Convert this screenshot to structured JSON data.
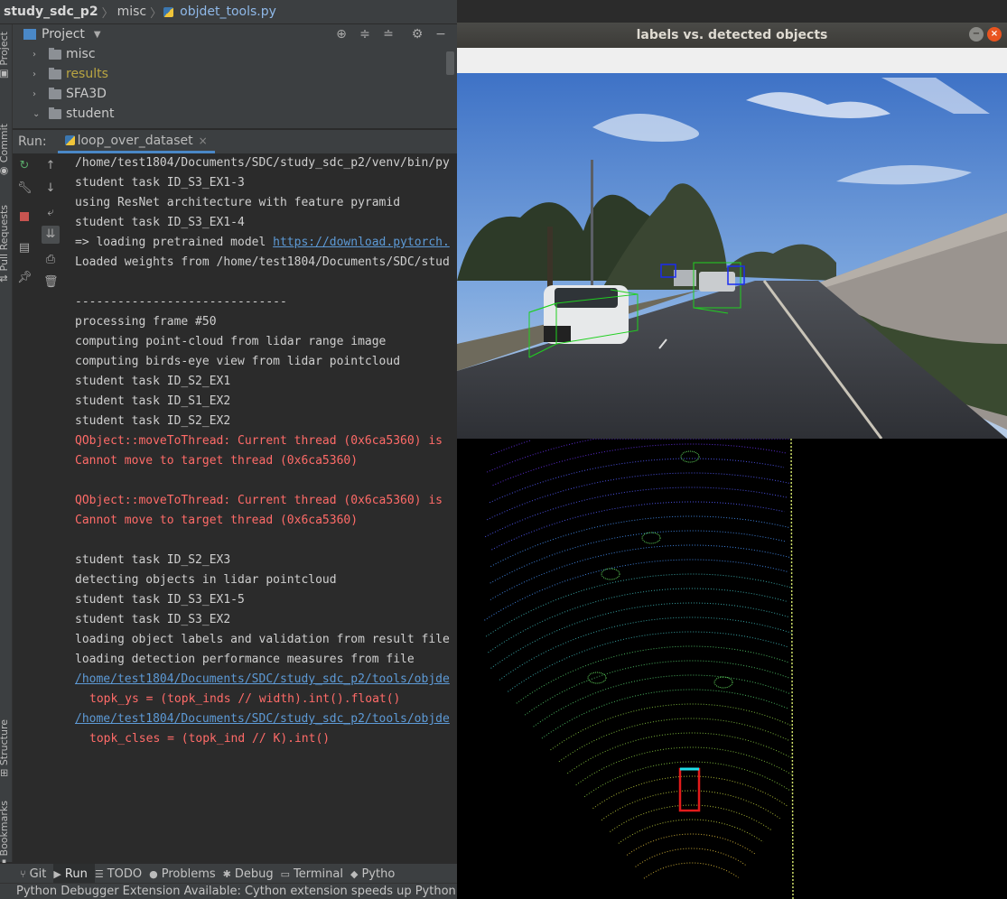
{
  "breadcrumb": {
    "project": "study_sdc_p2",
    "folder": "misc",
    "file": "objdet_tools.py"
  },
  "left_strip": {
    "project_tab": "Project",
    "commit_tab": "Commit",
    "pull_tab": "Pull Requests",
    "structure_tab": "Structure",
    "bookmarks_tab": "Bookmarks"
  },
  "project_panel": {
    "title": "Project",
    "items": [
      {
        "label": "misc",
        "color": "#c9c9c9",
        "expanded": false
      },
      {
        "label": "results",
        "color": "#b9a542",
        "expanded": false
      },
      {
        "label": "SFA3D",
        "color": "#c9c9c9",
        "expanded": false
      },
      {
        "label": "student",
        "color": "#c9c9c9",
        "expanded": true
      }
    ]
  },
  "run_bar": {
    "label": "Run:",
    "tab": "loop_over_dataset"
  },
  "console": {
    "lines": [
      {
        "text": "/home/test1804/Documents/SDC/study_sdc_p2/venv/bin/py",
        "type": "normal"
      },
      {
        "text": "student task ID_S3_EX1-3",
        "type": "normal"
      },
      {
        "text": "using ResNet architecture with feature pyramid",
        "type": "normal"
      },
      {
        "text": "student task ID_S3_EX1-4",
        "type": "normal"
      },
      {
        "text": "=> loading pretrained model ",
        "link": "https://download.pytorch.",
        "type": "mixed"
      },
      {
        "text": "Loaded weights from /home/test1804/Documents/SDC/stud",
        "type": "normal"
      },
      {
        "text": "",
        "type": "normal"
      },
      {
        "text": "------------------------------",
        "type": "normal"
      },
      {
        "text": "processing frame #50",
        "type": "normal"
      },
      {
        "text": "computing point-cloud from lidar range image",
        "type": "normal"
      },
      {
        "text": "computing birds-eye view from lidar pointcloud",
        "type": "normal"
      },
      {
        "text": "student task ID_S2_EX1",
        "type": "normal"
      },
      {
        "text": "student task ID_S1_EX2",
        "type": "normal"
      },
      {
        "text": "student task ID_S2_EX2",
        "type": "normal"
      },
      {
        "text": "QObject::moveToThread: Current thread (0x6ca5360) is",
        "type": "err"
      },
      {
        "text": "Cannot move to target thread (0x6ca5360)",
        "type": "err"
      },
      {
        "text": "",
        "type": "normal"
      },
      {
        "text": "QObject::moveToThread: Current thread (0x6ca5360) is",
        "type": "err"
      },
      {
        "text": "Cannot move to target thread (0x6ca5360)",
        "type": "err"
      },
      {
        "text": "",
        "type": "normal"
      },
      {
        "text": "student task ID_S2_EX3",
        "type": "normal"
      },
      {
        "text": "detecting objects in lidar pointcloud",
        "type": "normal"
      },
      {
        "text": "student task ID_S3_EX1-5",
        "type": "normal"
      },
      {
        "text": "student task ID_S3_EX2",
        "type": "normal"
      },
      {
        "text": "loading object labels and validation from result file",
        "type": "normal"
      },
      {
        "text": "loading detection performance measures from file",
        "type": "normal"
      },
      {
        "text": "/home/test1804/Documents/SDC/study_sdc_p2/tools/objde",
        "type": "link"
      },
      {
        "text": "topk_ys = (topk_inds // width).int().float()",
        "type": "ind"
      },
      {
        "text": "/home/test1804/Documents/SDC/study_sdc_p2/tools/objde",
        "type": "link"
      },
      {
        "text": "topk_clses = (topk_ind // K).int()",
        "type": "ind"
      }
    ]
  },
  "bottom_tabs": [
    {
      "label": "Git",
      "icon": "git-icon",
      "active": false
    },
    {
      "label": "Run",
      "icon": "run-icon",
      "active": true
    },
    {
      "label": "TODO",
      "icon": "todo-icon",
      "active": false
    },
    {
      "label": "Problems",
      "icon": "problems-icon",
      "active": false
    },
    {
      "label": "Debug",
      "icon": "debug-icon",
      "active": false
    },
    {
      "label": "Terminal",
      "icon": "terminal-icon",
      "active": false
    },
    {
      "label": "Pytho",
      "icon": "python-console-icon",
      "active": false
    }
  ],
  "status_bar": {
    "text": "Python Debugger Extension Available: Cython extension speeds up Python"
  },
  "cv_window": {
    "title": "labels vs. detected objects"
  }
}
